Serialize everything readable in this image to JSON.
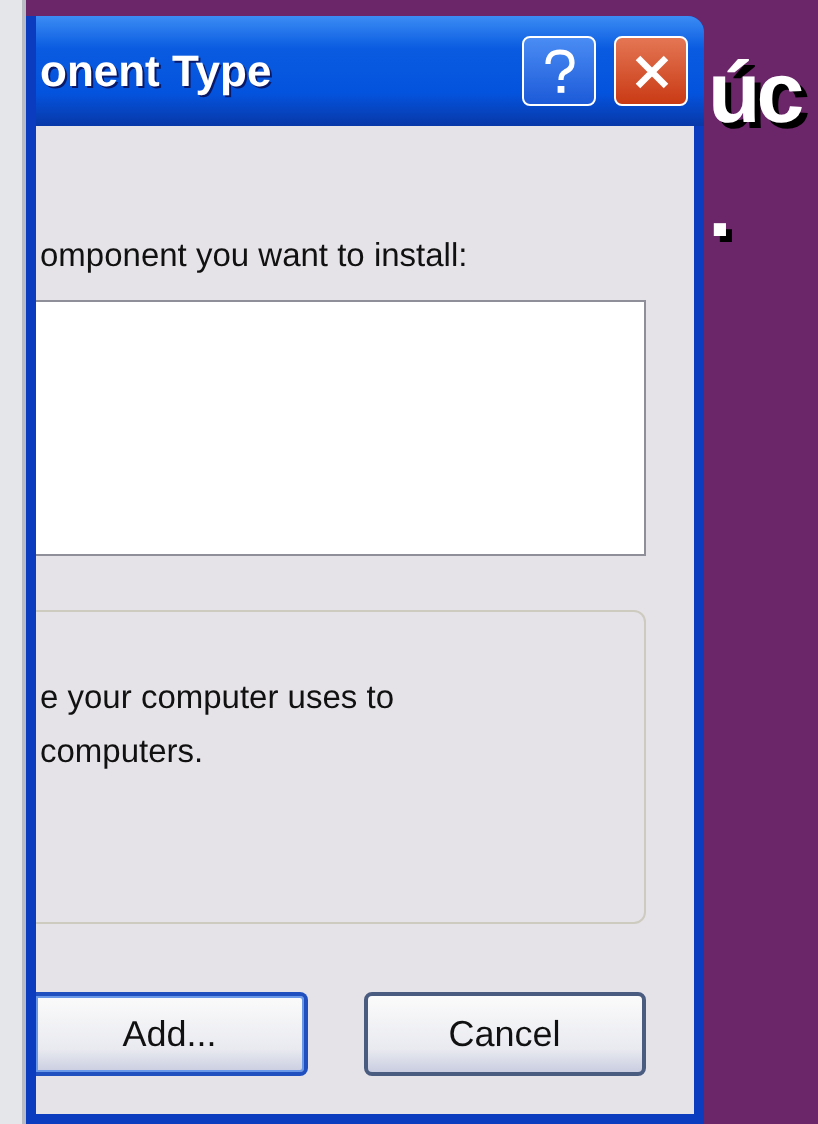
{
  "slide": {
    "lines": [
      "úc",
      "."
    ]
  },
  "window": {
    "title": "onent Type"
  },
  "prompt": "omponent you want to install:",
  "description": [
    "e your computer uses to",
    "computers."
  ],
  "buttons": [
    {
      "label": "Add...",
      "default": true
    },
    {
      "label": "Cancel",
      "default": false
    }
  ]
}
